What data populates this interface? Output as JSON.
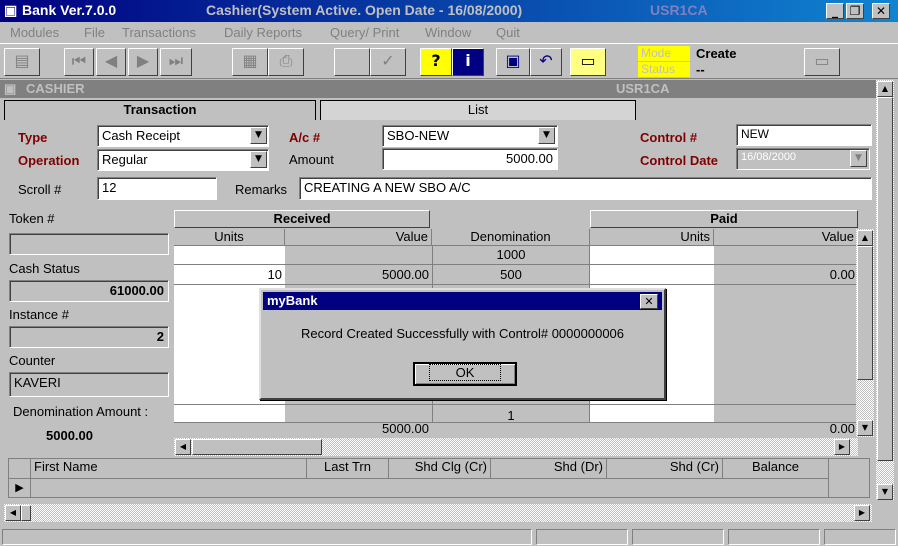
{
  "window": {
    "app_title": "Bank Ver.7.0.0",
    "subtitle": "Cashier(System Active. Open Date - 16/08/2000)",
    "user": "USR1CA",
    "minimize": "_",
    "maximize": "❐",
    "close": "✕"
  },
  "menu": [
    "Modules",
    "File",
    "Transactions",
    "Daily Reports",
    "Query/ Print",
    "Window",
    "Quit"
  ],
  "mode": {
    "mode_label": "Mode",
    "mode_value": "Create",
    "status_label": "Status",
    "status_value": "--"
  },
  "child_window": {
    "title": "CASHIER",
    "user": "USR1CA"
  },
  "tabs": {
    "active": "Transaction",
    "other": "List"
  },
  "form": {
    "type_label": "Type",
    "type_value": "Cash Receipt",
    "operation_label": "Operation",
    "operation_value": "Regular",
    "ac_label": "A/c #",
    "ac_value": "SBO-NEW",
    "amount_label": "Amount",
    "amount_value": "5000.00",
    "control_label": "Control #",
    "control_value": "NEW",
    "control_date_label": "Control Date",
    "control_date_value": "16/08/2000",
    "scroll_label": "Scroll #",
    "scroll_value": "12",
    "remarks_label": "Remarks",
    "remarks_value": "CREATING A NEW SBO A/C"
  },
  "sidebar": {
    "token_label": "Token #",
    "token_value": "",
    "cash_status_label": "Cash Status",
    "cash_status_value": "61000.00",
    "instance_label": "Instance #",
    "instance_value": "2",
    "counter_label": "Counter",
    "counter_value": "KAVERI",
    "denom_amount_label": "Denomination Amount :",
    "denom_amount_value": "5000.00"
  },
  "grid": {
    "received_header": "Received",
    "paid_header": "Paid",
    "columns": [
      "Units",
      "Value",
      "Denomination",
      "Units",
      "Value"
    ],
    "denominations": [
      "1000",
      "500",
      "1"
    ],
    "row_500_units": "10",
    "row_500_value": "5000.00",
    "row_500_paid_value": "0.00",
    "total_received": "5000.00",
    "total_paid": "0.00"
  },
  "dialog": {
    "title": "myBank",
    "message": "Record Created Successfully with Control# 0000000006",
    "ok_label": "OK",
    "close": "✕"
  },
  "bottom_table": {
    "columns": [
      "First Name",
      "Last Trn",
      "Shd Clg (Cr)",
      "Shd (Dr)",
      "Shd (Cr)",
      "Balance"
    ]
  }
}
